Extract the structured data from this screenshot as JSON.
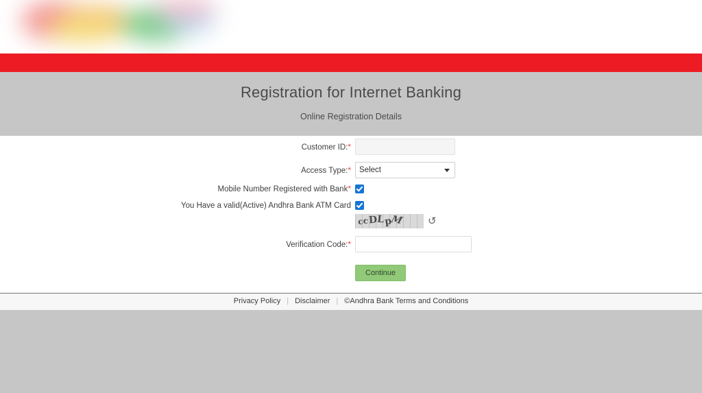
{
  "branding": {
    "logo_alt": "bank-logo-blurred",
    "accent_red": "#ED1C24",
    "header_gray": "#C6C6C6",
    "button_green": "#90C978",
    "required_red": "#E8453C",
    "checkbox_blue": "#1675D1"
  },
  "header": {
    "title": "Registration for Internet Banking",
    "subtitle": "Online Registration Details"
  },
  "form": {
    "customer_id": {
      "label": "Customer ID:",
      "required_mark": "*",
      "value": "",
      "placeholder": ""
    },
    "access_type": {
      "label": "Access Type:",
      "required_mark": "*",
      "selected": "Select"
    },
    "mobile_registered": {
      "label": "Mobile Number Registered with Bank",
      "required_mark": "*",
      "checked": true
    },
    "atm_card": {
      "label": "You Have a valid(Active) Andhra Bank ATM Card",
      "required_mark": "",
      "checked": true
    },
    "captcha": {
      "text": "ccDLpM",
      "chars": [
        "c",
        "c",
        "D",
        "L",
        "p",
        "M"
      ],
      "refresh_icon": "↺"
    },
    "verification_code": {
      "label": "Verification Code:",
      "required_mark": "*",
      "value": "",
      "placeholder": ""
    },
    "submit": {
      "label": "Continue"
    }
  },
  "footer": {
    "links": [
      {
        "label": "Privacy Policy"
      },
      {
        "label": "Disclaimer"
      },
      {
        "label": "©Andhra Bank Terms and Conditions"
      }
    ],
    "separator": "|"
  }
}
